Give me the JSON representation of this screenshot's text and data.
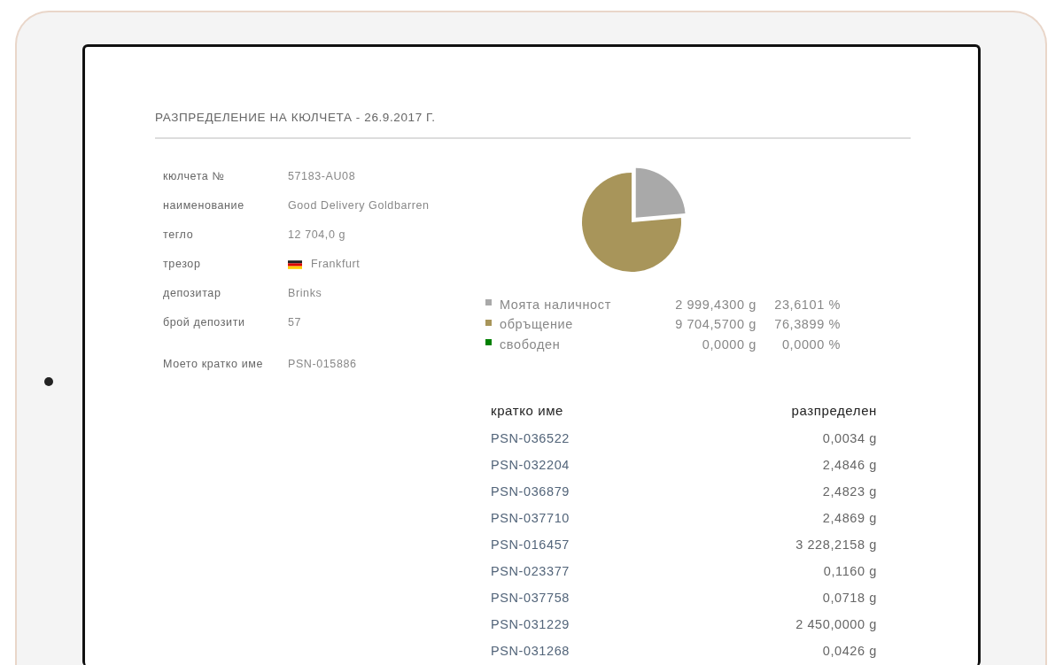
{
  "title": "РАЗПРЕДЕЛЕНИЕ НА КЮЛЧЕТА - 26.9.2017 Г.",
  "details": [
    {
      "label": "кюлчета №",
      "value": "57183-AU08"
    },
    {
      "label": "наименование",
      "value": "Good Delivery Goldbarren"
    },
    {
      "label": "тегло",
      "value": "12 704,0 g"
    },
    {
      "label": "трезор",
      "value": "Frankfurt",
      "kind": "flag"
    },
    {
      "label": "депозитар",
      "value": "Brinks"
    },
    {
      "label": "брой депозити",
      "value": "57"
    },
    {
      "label": "Моето кратко име",
      "value": "PSN-015886",
      "kind": "separated"
    }
  ],
  "chart": {
    "chart_data": {
      "type": "pie",
      "categories": [
        "Моята наличност",
        "обръщение",
        "свободен"
      ],
      "values": [
        23.6101,
        76.3899,
        0
      ]
    }
  },
  "legend": [
    {
      "color": "#a9a9a9",
      "amount": "2 999,4300 g",
      "percent": "23,6101 %"
    },
    {
      "color": "#a8955a",
      "amount": "9 704,5700 g",
      "percent": "76,3899 %"
    },
    {
      "color": "#008000",
      "amount": "0,0000 g",
      "percent": "0,0000 %"
    }
  ],
  "table": {
    "columns": [
      "кратко име",
      "разпределен"
    ],
    "rows": [
      [
        "PSN-036522",
        "0,0034 g"
      ],
      [
        "PSN-032204",
        "2,4846 g"
      ],
      [
        "PSN-036879",
        "2,4823 g"
      ],
      [
        "PSN-037710",
        "2,4869 g"
      ],
      [
        "PSN-016457",
        "3 228,2158 g"
      ],
      [
        "PSN-023377",
        "0,1160 g"
      ],
      [
        "PSN-037758",
        "0,0718 g"
      ],
      [
        "PSN-031229",
        "2 450,0000 g"
      ],
      [
        "PSN-031268",
        "0,0426 g"
      ]
    ]
  }
}
